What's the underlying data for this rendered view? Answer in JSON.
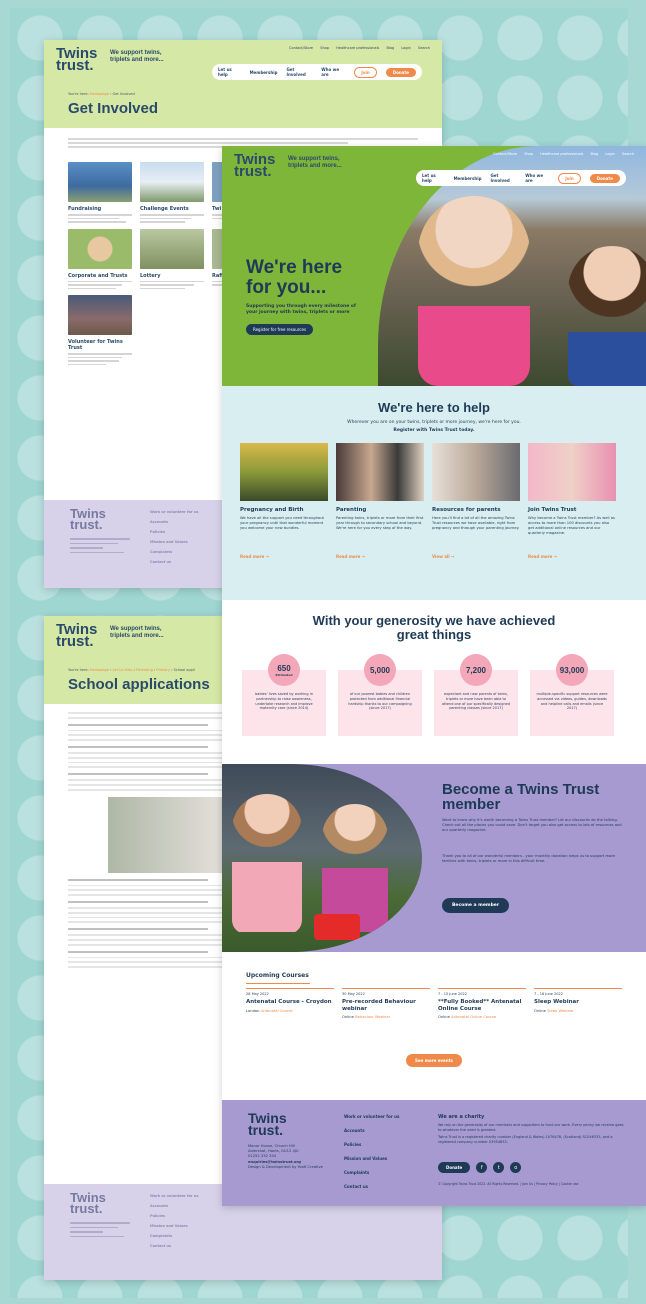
{
  "logo": {
    "line1": "Twins",
    "line2": "trust.",
    "tagline": "We support twins, triplets and more..."
  },
  "toplinks": [
    "Contact/Store",
    "Shop",
    "Healthcare professionals",
    "Blog",
    "Login",
    "Search"
  ],
  "nav": {
    "items": [
      "Let us help",
      "Membership",
      "Get Involved",
      "Who we are"
    ],
    "join": "Join",
    "donate": "Donate"
  },
  "page_get_involved": {
    "breadcrumb": [
      "You're here:",
      "Homepage",
      "Get Involved"
    ],
    "title": "Get Involved",
    "cards": [
      "Fundraising",
      "Challenge Events",
      "Twi",
      "Corporate and Trusts",
      "Lottery",
      "Raffl",
      "Volunteer for Twins Trust"
    ],
    "footer_links": [
      "Work or volunteer for us",
      "Accounts",
      "Policies",
      "Mission and Values",
      "Complaints",
      "Contact us"
    ]
  },
  "page_school": {
    "breadcrumb": [
      "You're here:",
      "Homepage",
      "Let Us Help",
      "Parenting",
      "Primary",
      "School appli"
    ],
    "title": "School applications"
  },
  "hero": {
    "heading_line1": "We're here",
    "heading_line2": "for you...",
    "sub": "Supporting you through every milestone of your journey with twins, triplets or more",
    "cta": "Register for free resources"
  },
  "help": {
    "title": "We're here to help",
    "intro": "Wherever you are on your twins, triplets or more journey, we're here for you.",
    "intro_bold": "Register with Twins Trust today.",
    "cards": [
      {
        "title": "Pregnancy and Birth",
        "desc": "We have all the support you need throughout your pregnancy until that wonderful moment you welcome your new bundles.",
        "link": "Read more →"
      },
      {
        "title": "Parenting",
        "desc": "Parenting twins, triplets or more from their first year through to secondary school and beyond. We're here for you every step of the way.",
        "link": "Read more →"
      },
      {
        "title": "Resources for parents",
        "desc": "Here you'll find a lot of all the amazing Twins Trust resources we have available, right from pregnancy and through your parenting journey.",
        "link": "View all →"
      },
      {
        "title": "Join Twins Trust",
        "desc": "Why become a Twins Trust member? As well as access to more than 100 discounts you also get additional online resources and our quarterly magazine.",
        "link": "Read more →"
      }
    ]
  },
  "generosity": {
    "title": "With your generosity we have achieved great things",
    "stats": [
      {
        "num": "650",
        "label": "Estimated",
        "desc": "babies' lives saved by working in partnership to raise awareness, undertake research and improve maternity care (since 2014)"
      },
      {
        "num": "5,000",
        "label": "",
        "desc": "of our poorest babies and children protected from additional financial hardship thanks to our campaigning (since 2017)"
      },
      {
        "num": "7,200",
        "label": "",
        "desc": "expectant and new parents of twins, triplets or more have been able to attend one of our specifically designed parenting classes (since 2017)"
      },
      {
        "num": "93,000",
        "label": "",
        "desc": "multiple-specific support resources were accessed via videos, guides, downloads and helpline calls and emails (since 2017)"
      }
    ]
  },
  "member": {
    "title": "Become a Twins Trust member",
    "desc1": "Want to know why it's worth becoming a Twins Trust member? Let our discounts do the talking. Check out all the places you could save. Don't forget you also get access to lots of resources and our quarterly magazine.",
    "desc2": "Thank you to all of our wonderful members - your monthly donation helps us to support more families with twins, triplets or more in this difficult time.",
    "cta": "Become a member"
  },
  "courses": {
    "title": "Upcoming Courses",
    "items": [
      {
        "date": "28 May 2022",
        "title": "Antenatal Course - Croydon",
        "where": "London",
        "type": "Antenatal Course"
      },
      {
        "date": "30 May 2022",
        "title": "Pre-recorded Behaviour webinar",
        "where": "Online",
        "type": "Behaviour Webinar"
      },
      {
        "date": "7 - 15 June 2022",
        "title": "**Fully Booked** Antenatal Online Course",
        "where": "Online",
        "type": "Antenatal Online Course"
      },
      {
        "date": "7 - 16 June 2022",
        "title": "Sleep Webinar",
        "where": "Online",
        "type": "Sleep Webinar"
      }
    ],
    "see_more": "See more events"
  },
  "footer": {
    "address": [
      "Manor House, Church Hill",
      "Aldershot, Hants, GU12 4JU",
      "01252 332 344"
    ],
    "email": "enquiries@twinstrust.org",
    "credit": "Design & Development by Yoo6 Creative",
    "links": [
      "Work or volunteer for us",
      "Accounts",
      "Policies",
      "Mission and Values",
      "Complaints",
      "Contact us"
    ],
    "charity_title": "We are a charity",
    "charity_desc": "We rely on the generosity of our members and supporters to fund our work. Every penny we receive goes to whatever the need is greatest.",
    "charity_reg": "Twins Trust is a registered charity number (England & Wales) 1076478, (Scotland) SC046333, and a registered company number 03954633.",
    "donate": "Donate",
    "social": [
      "f",
      "t",
      "o"
    ],
    "copyright": "© Copyright Twins Trust 2022. All Rights Reserved. | Join Us | Privacy Policy | Cookie use"
  }
}
